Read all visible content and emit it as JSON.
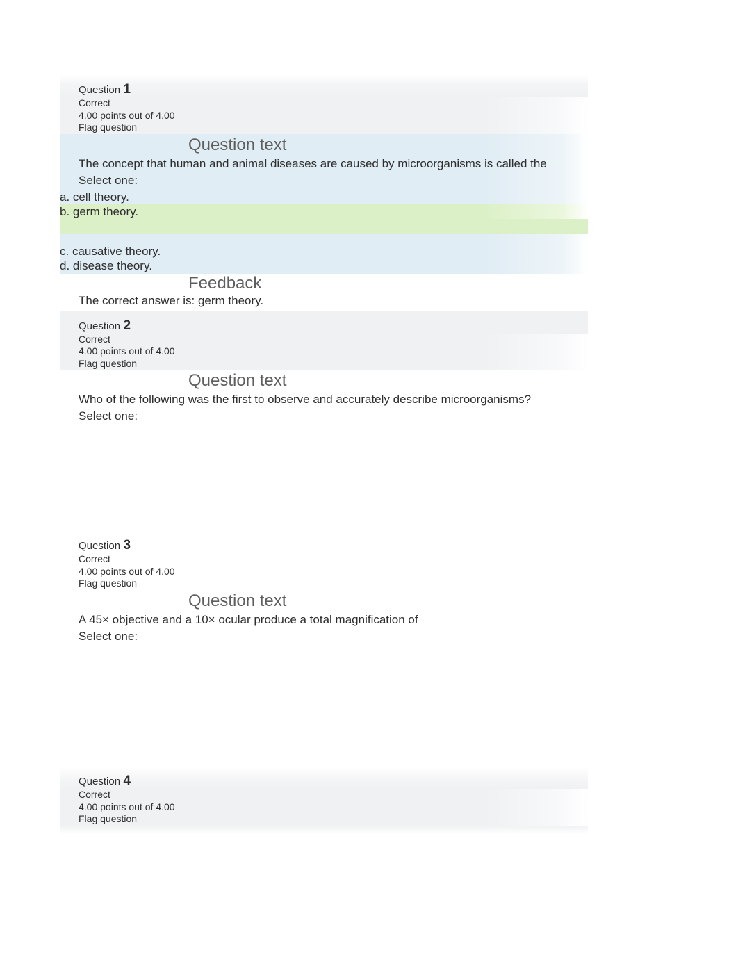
{
  "questions": [
    {
      "label": "Question",
      "number": "1",
      "status": "Correct",
      "points": "4.00 points out of 4.00",
      "flag": "Flag question",
      "question_text_heading": "Question text",
      "prompt": "The concept that human and animal diseases are caused by microorganisms is called the",
      "select_one": "Select one:",
      "options": {
        "a": "a. cell theory.",
        "b": "b. germ theory.",
        "c": "c. causative theory.",
        "d": "d. disease theory."
      },
      "feedback_heading": "Feedback",
      "feedback_text": "The correct answer is: germ theory."
    },
    {
      "label": "Question",
      "number": "2",
      "status": "Correct",
      "points": "4.00 points out of 4.00",
      "flag": "Flag question",
      "question_text_heading": "Question text",
      "prompt": "Who of the following was the first to observe and accurately describe microorganisms?",
      "select_one": "Select one:"
    },
    {
      "label": "Question",
      "number": "3",
      "status": "Correct",
      "points": "4.00 points out of 4.00",
      "flag": "Flag question",
      "question_text_heading": "Question text",
      "prompt": "A 45× objective and a 10× ocular produce a total magnification of",
      "select_one": "Select one:"
    },
    {
      "label": "Question",
      "number": "4",
      "status": "Correct",
      "points": "4.00 points out of 4.00",
      "flag": "Flag question"
    }
  ]
}
